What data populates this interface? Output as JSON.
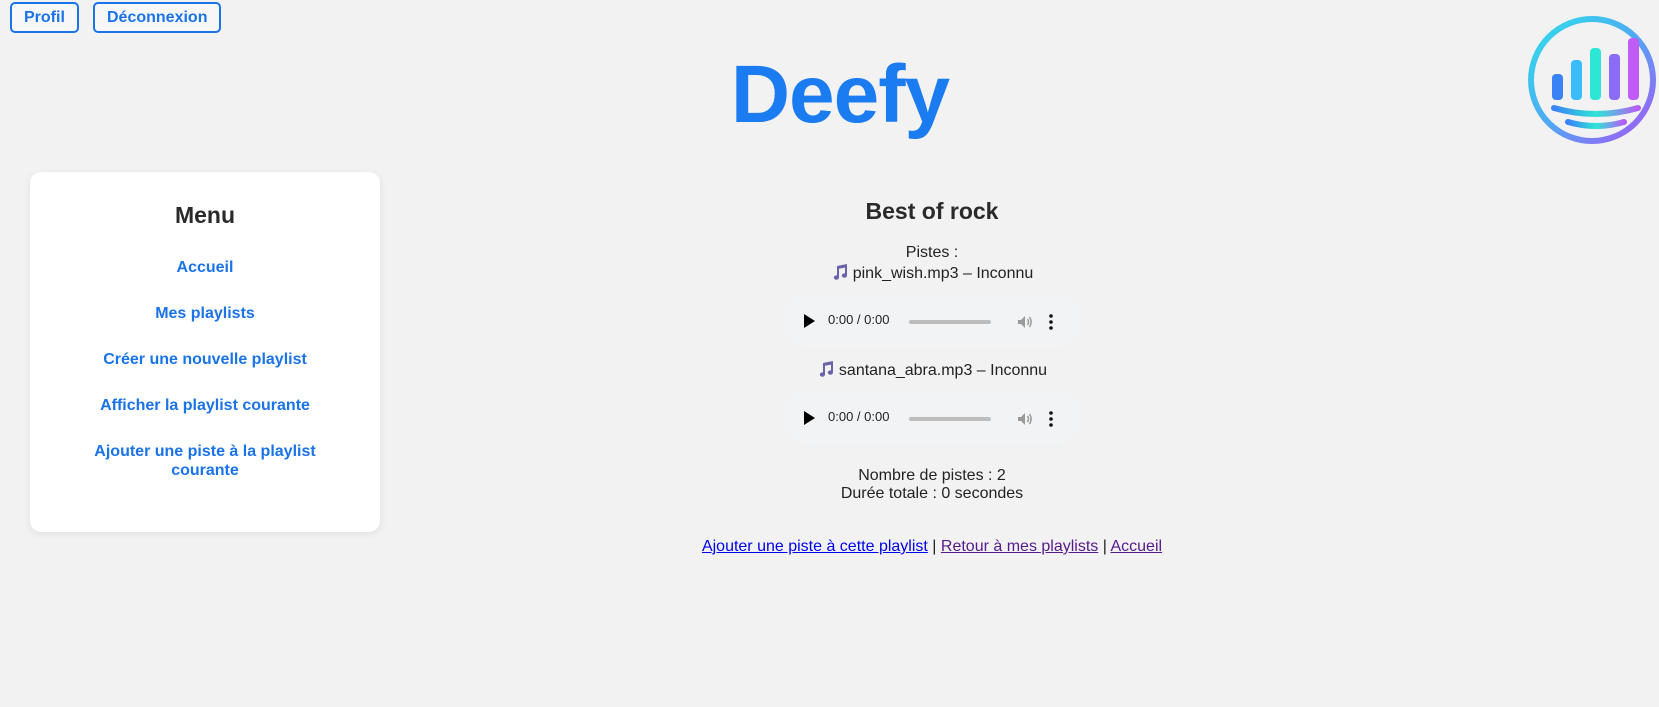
{
  "header": {
    "profile_label": "Profil",
    "logout_label": "Déconnexion",
    "title": "Deefy"
  },
  "menu": {
    "title": "Menu",
    "items": [
      {
        "label": "Accueil"
      },
      {
        "label": "Mes playlists"
      },
      {
        "label": "Créer une nouvelle playlist"
      },
      {
        "label": "Afficher la playlist courante"
      },
      {
        "label": "Ajouter une piste à la playlist courante"
      }
    ]
  },
  "playlist": {
    "title": "Best of rock",
    "tracks_label": "Pistes :",
    "tracks": [
      {
        "label": "pink_wish.mp3 – Inconnu",
        "time": "0:00 / 0:00"
      },
      {
        "label": "santana_abra.mp3 – Inconnu",
        "time": "0:00 / 0:00"
      }
    ],
    "count_text": "Nombre de pistes : 2",
    "duration_text": "Durée totale : 0 secondes"
  },
  "links": {
    "add_track": "Ajouter une piste à cette playlist",
    "back": "Retour à mes playlists",
    "home": "Accueil",
    "separator": "|"
  },
  "icons": {
    "track": "music-note-icon",
    "play": "play-icon",
    "volume": "volume-icon",
    "more": "more-vertical-icon",
    "logo": "equalizer-logo-icon"
  },
  "colors": {
    "accent": "#1a73e8",
    "title": "#1a7cf0",
    "background": "#f2f2f2"
  }
}
